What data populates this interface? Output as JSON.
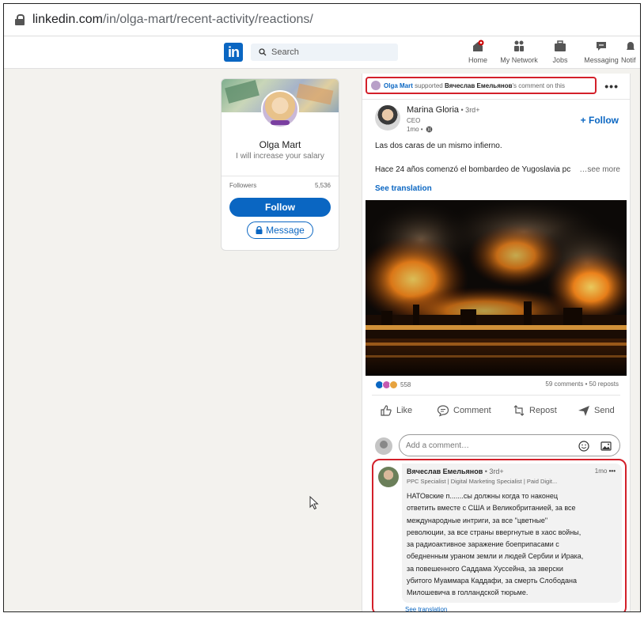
{
  "browser": {
    "url_host": "linkedin.com",
    "url_path": "/in/olga-mart/recent-activity/reactions/"
  },
  "topnav": {
    "logo": "in",
    "search_placeholder": "Search",
    "items": [
      {
        "label": "Home",
        "icon": "home-icon"
      },
      {
        "label": "My Network",
        "icon": "network-icon"
      },
      {
        "label": "Jobs",
        "icon": "briefcase-icon"
      },
      {
        "label": "Messaging",
        "icon": "messaging-icon"
      },
      {
        "label": "Notif",
        "icon": "bell-icon"
      }
    ]
  },
  "profile": {
    "name": "Olga Mart",
    "headline": "I will increase your salary",
    "followers_label": "Followers",
    "followers_count": "5,536",
    "follow_label": "Follow",
    "message_label": "Message"
  },
  "activity": {
    "actor": "Olga Mart",
    "verb": " supported ",
    "target": "Вячеслав Емельянов",
    "suffix": "'s comment on this"
  },
  "post": {
    "author_name": "Marina Gloria",
    "author_degree": " • 3rd+",
    "author_title": "CEO",
    "time": "1mo •",
    "follow_label": "+ Follow",
    "text_line1": "Las dos caras de un mismo infierno.",
    "text_line2": "Hace 24 años comenzó el bombardeo de Yugoslavia pc",
    "see_more": "…see more",
    "see_translation": "See translation",
    "reactions_count": "558",
    "comments_reposts": "59 comments • 50 reposts",
    "actions": {
      "like": "Like",
      "comment": "Comment",
      "repost": "Repost",
      "send": "Send"
    },
    "comment_placeholder": "Add a comment…"
  },
  "comment": {
    "author_name": "Вячеслав Емельянов",
    "author_degree": " • 3rd+",
    "time": "1mo",
    "headline": "PPC Specialist | Digital Marketing Specialist | Paid Digit...",
    "lines": [
      "НАТОвские п.......сы должны когда то наконец",
      "ответить вместе с США и Великобританией, за все",
      "международные интриги, за все \"цветные\"",
      "революции, за все страны ввергнутые в хаос войны,",
      "за радиоактивное заражение боеприпасами с",
      "обедненным ураном земли и людей Сербии и Ирака,",
      "за повешенного Саддама Хуссейна, за зверски",
      "убитого Муаммара Каддафи, за смерть Слободана",
      "Милошевича в голландской тюрьме."
    ],
    "see_translation": "See translation"
  },
  "colors": {
    "linkedin_blue": "#0a66c2",
    "highlight_red": "#d3202a"
  }
}
